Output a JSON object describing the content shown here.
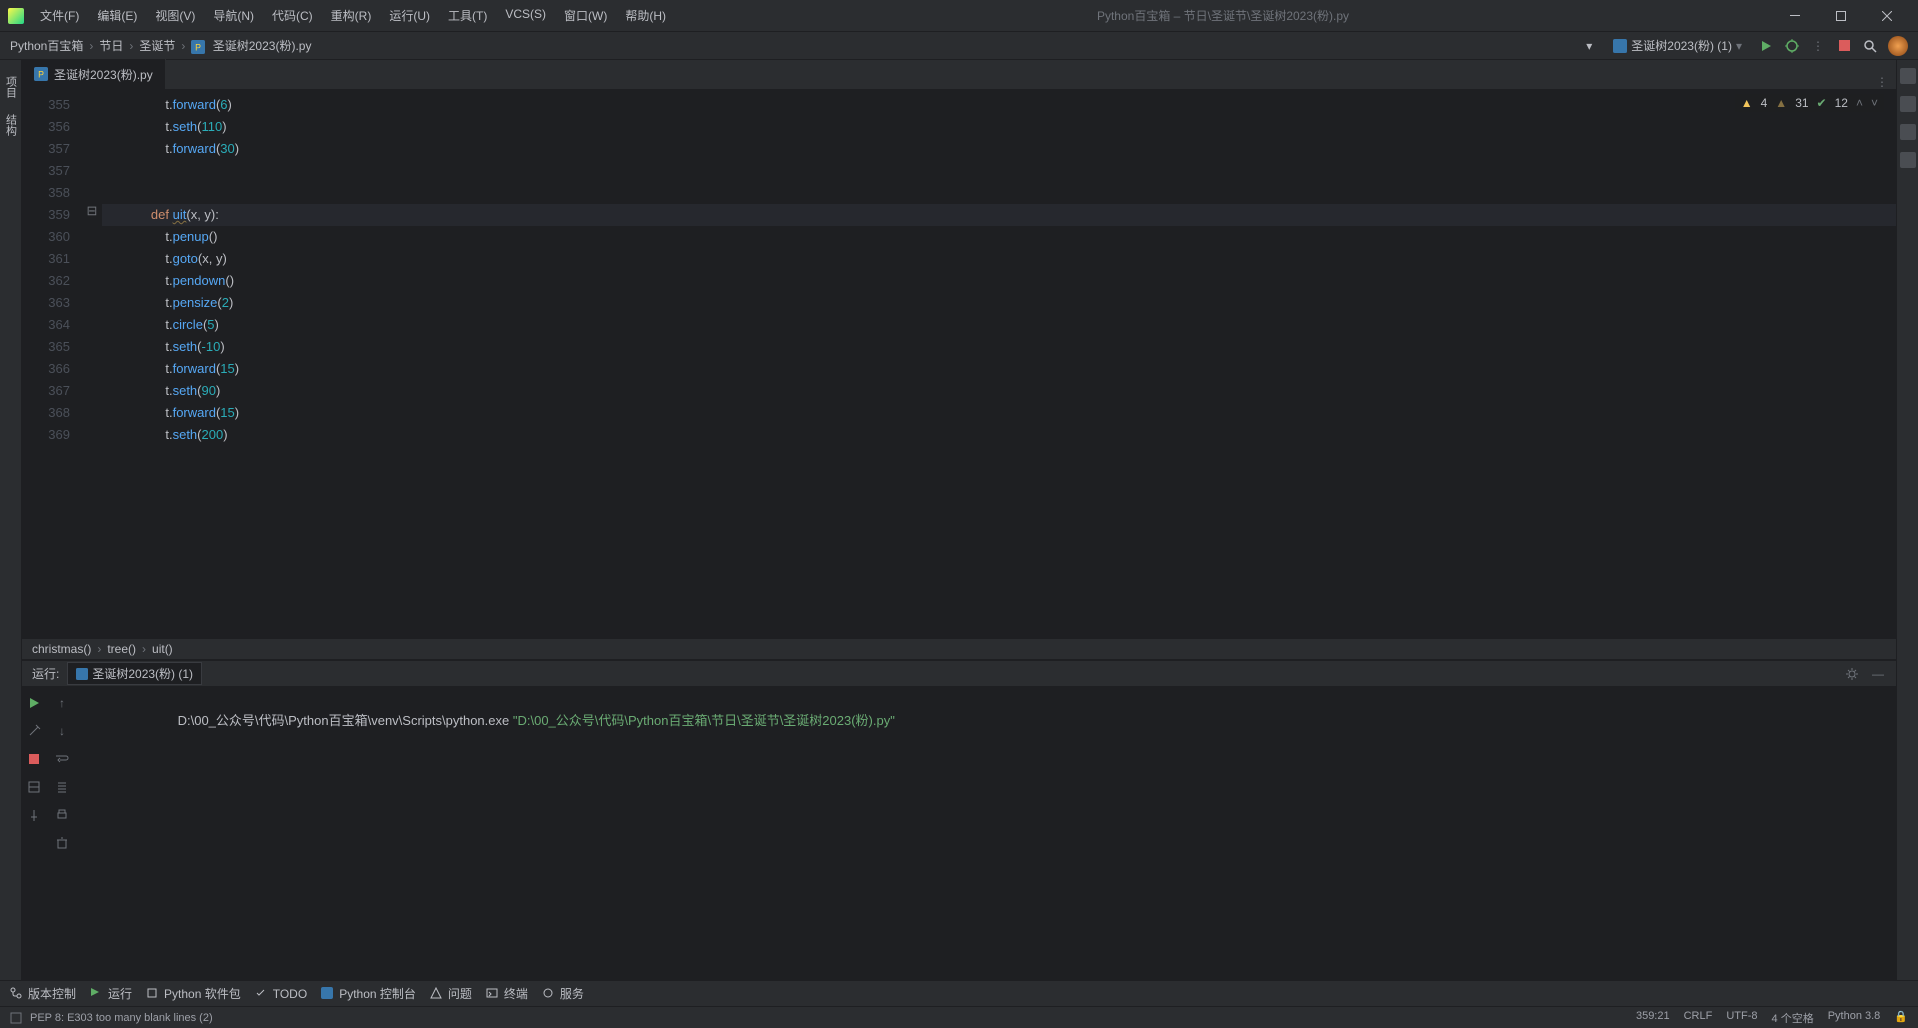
{
  "app": {
    "title": "Python百宝箱 – 节日\\圣诞节\\圣诞树2023(粉).py",
    "product": "PyCharm"
  },
  "menu": [
    "文件(F)",
    "编辑(E)",
    "视图(V)",
    "导航(N)",
    "代码(C)",
    "重构(R)",
    "运行(U)",
    "工具(T)",
    "VCS(S)",
    "窗口(W)",
    "帮助(H)"
  ],
  "breadcrumbs": {
    "project": "Python百宝箱",
    "folder1": "节日",
    "folder2": "圣诞节",
    "file": "圣诞树2023(粉).py"
  },
  "run_config": {
    "name": "圣诞树2023(粉) (1)"
  },
  "tabs": [
    {
      "label": "圣诞树2023(粉).py"
    }
  ],
  "inspections": {
    "warnings": "4",
    "weak": "31",
    "typos": "12"
  },
  "code": {
    "lines": [
      {
        "n": "355",
        "indent": 3,
        "text": "t.forward(6)"
      },
      {
        "n": "356",
        "indent": 3,
        "text": "t.seth(110)"
      },
      {
        "n": "357",
        "indent": 3,
        "text": "t.forward(30)"
      },
      {
        "n": "357",
        "indent": 0,
        "text": ""
      },
      {
        "n": "358",
        "indent": 0,
        "text": ""
      },
      {
        "n": "359",
        "indent": 2,
        "text": "def uit(x, y):",
        "def": true,
        "hl": true
      },
      {
        "n": "360",
        "indent": 3,
        "text": "t.penup()"
      },
      {
        "n": "361",
        "indent": 3,
        "text": "t.goto(x, y)"
      },
      {
        "n": "362",
        "indent": 3,
        "text": "t.pendown()"
      },
      {
        "n": "363",
        "indent": 3,
        "text": "t.pensize(2)"
      },
      {
        "n": "364",
        "indent": 3,
        "text": "t.circle(5)"
      },
      {
        "n": "365",
        "indent": 3,
        "text": "t.seth(-10)"
      },
      {
        "n": "366",
        "indent": 3,
        "text": "t.forward(15)"
      },
      {
        "n": "367",
        "indent": 3,
        "text": "t.seth(90)"
      },
      {
        "n": "368",
        "indent": 3,
        "text": "t.forward(15)"
      },
      {
        "n": "369",
        "indent": 3,
        "text": "t.seth(200)"
      }
    ]
  },
  "crumbs2": [
    "christmas()",
    "tree()",
    "uit()"
  ],
  "run_panel": {
    "label": "运行:",
    "tab": "圣诞树2023(粉) (1)",
    "output_prefix": "D:\\00_公众号\\代码\\Python百宝箱\\venv\\Scripts\\python.exe ",
    "output_arg": "\"D:\\00_公众号\\代码\\Python百宝箱\\节日\\圣诞节\\圣诞树2023(粉).py\""
  },
  "bottom_toolbar": [
    "版本控制",
    "运行",
    "Python 软件包",
    "TODO",
    "Python 控制台",
    "问题",
    "终端",
    "服务"
  ],
  "statusbar": {
    "message": "PEP 8: E303 too many blank lines (2)",
    "position": "359:21",
    "line_sep": "CRLF",
    "encoding": "UTF-8",
    "indent": "4 个空格",
    "interpreter": "Python 3.8"
  }
}
